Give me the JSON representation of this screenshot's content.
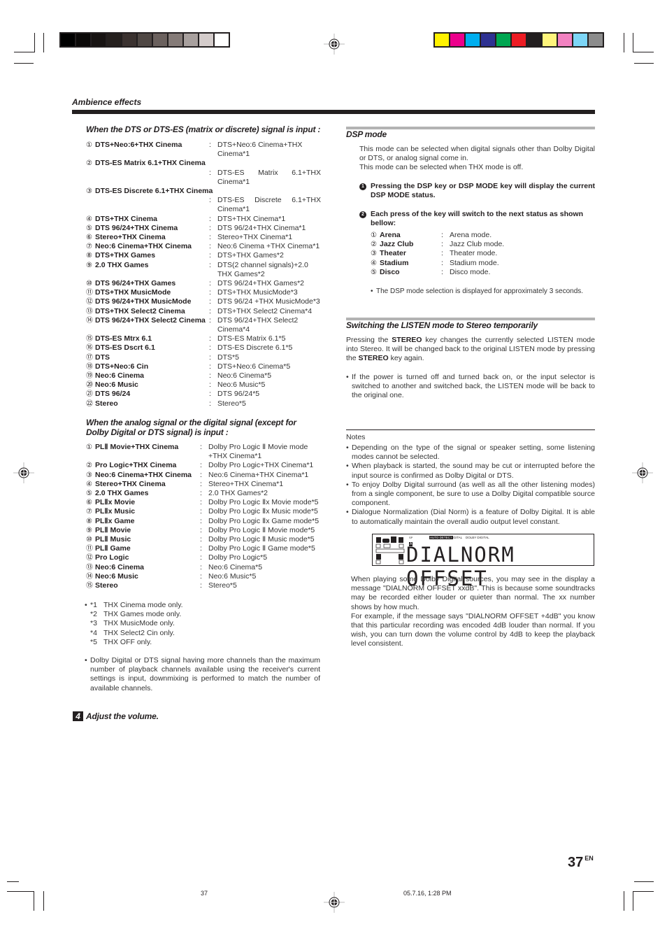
{
  "printer_marks": {
    "grayscale_colors": [
      "#000000",
      "#0b0908",
      "#181413",
      "#25201e",
      "#3b3230",
      "#4f4744",
      "#6b615e",
      "#857b78",
      "#a8a09e",
      "#d4cccb",
      "#ffffff"
    ],
    "process_colors": [
      "#fff200",
      "#ec008c",
      "#00aeef",
      "#2e3192",
      "#00a651",
      "#ed1c24",
      "#231f20",
      "#fff57c",
      "#f282c1",
      "#7dd6f7",
      "#8c8c8c"
    ]
  },
  "header": {
    "section_title": "Ambience effects"
  },
  "left": {
    "dts_heading": "When the DTS or DTS-ES (matrix or discrete) signal is input :",
    "dts_modes": [
      {
        "num": "①",
        "name": "DTS+Neo:6+THX Cinema",
        "desc": "DTS+Neo:6 Cinema+THX Cinema*1",
        "wrap": false
      },
      {
        "num": "②",
        "name": "DTS-ES Matrix 6.1+THX Cinema",
        "desc": "DTS-ES Matrix 6.1+THX Cinema*1",
        "wrap": true
      },
      {
        "num": "③",
        "name": "DTS-ES Discrete 6.1+THX Cinema",
        "desc": "DTS-ES Discrete 6.1+THX Cinema*1",
        "wrap": true
      },
      {
        "num": "④",
        "name": "DTS+THX Cinema",
        "desc": "DTS+THX Cinema*1",
        "wrap": false
      },
      {
        "num": "⑤",
        "name": "DTS 96/24+THX Cinema",
        "desc": "DTS 96/24+THX Cinema*1",
        "wrap": false
      },
      {
        "num": "⑥",
        "name": "Stereo+THX Cinema",
        "desc": "Stereo+THX Cinema*1",
        "wrap": false
      },
      {
        "num": "⑦",
        "name": "Neo:6 Cinema+THX Cinema",
        "desc": "Neo:6 Cinema +THX Cinema*1",
        "wrap": false
      },
      {
        "num": "⑧",
        "name": "DTS+THX Games",
        "desc": "DTS+THX Games*2",
        "wrap": false
      },
      {
        "num": "⑨",
        "name": "2.0 THX Games",
        "desc": "DTS(2 channel signals)+2.0 THX Games*2",
        "wrap": false
      },
      {
        "num": "⑩",
        "name": "DTS 96/24+THX Games",
        "desc": "DTS 96/24+THX Games*2",
        "wrap": false
      },
      {
        "num": "⑪",
        "name": "DTS+THX MusicMode",
        "desc": "DTS+THX MusicMode*3",
        "wrap": false
      },
      {
        "num": "⑫",
        "name": "DTS 96/24+THX MusicMode",
        "desc": "DTS 96/24 +THX MusicMode*3",
        "wrap": false
      },
      {
        "num": "⑬",
        "name": "DTS+THX Select2 Cinema",
        "desc": "DTS+THX Select2 Cinema*4",
        "wrap": false
      },
      {
        "num": "⑭",
        "name": "DTS 96/24+THX Select2 Cinema",
        "desc": "DTS 96/24+THX Select2 Cinema*4",
        "wrap": false
      },
      {
        "num": "⑮",
        "name": "DTS-ES Mtrx 6.1",
        "desc": "DTS-ES Matrix 6.1*5",
        "wrap": false
      },
      {
        "num": "⑯",
        "name": "DTS-ES Dscrt 6.1",
        "desc": "DTS-ES Discrete 6.1*5",
        "wrap": false
      },
      {
        "num": "⑰",
        "name": "DTS",
        "desc": "DTS*5",
        "wrap": false
      },
      {
        "num": "⑱",
        "name": "DTS+Neo:6 Cin",
        "desc": "DTS+Neo:6 Cinema*5",
        "wrap": false
      },
      {
        "num": "⑲",
        "name": "Neo:6 Cinema",
        "desc": "Neo:6 Cinema*5",
        "wrap": false
      },
      {
        "num": "⑳",
        "name": "Neo:6 Music",
        "desc": "Neo:6 Music*5",
        "wrap": false
      },
      {
        "num": "㉑",
        "name": "DTS 96/24",
        "desc": "DTS 96/24*5",
        "wrap": false
      },
      {
        "num": "㉒",
        "name": "Stereo",
        "desc": "Stereo*5",
        "wrap": false
      }
    ],
    "analog_heading": "When the analog signal or the digital signal (except for Dolby Digital or DTS signal) is input :",
    "analog_modes": [
      {
        "num": "①",
        "name": "PLⅡ Movie+THX Cinema",
        "desc": "Dolby Pro Logic Ⅱ Movie mode +THX Cinema*1"
      },
      {
        "num": "②",
        "name": "Pro Logic+THX Cinema",
        "desc": "Dolby Pro Logic+THX Cinema*1"
      },
      {
        "num": "③",
        "name": "Neo:6 Cinema+THX Cinema",
        "desc": "Neo:6 Cinema+THX Cinema*1"
      },
      {
        "num": "④",
        "name": "Stereo+THX Cinema",
        "desc": "Stereo+THX Cinema*1"
      },
      {
        "num": "⑤",
        "name": "2.0 THX Games",
        "desc": "2.0 THX Games*2"
      },
      {
        "num": "⑥",
        "name": "PLⅡx Movie",
        "desc": "Dolby Pro Logic Ⅱx Movie mode*5"
      },
      {
        "num": "⑦",
        "name": "PLⅡx Music",
        "desc": "Dolby Pro Logic Ⅱx Music mode*5"
      },
      {
        "num": "⑧",
        "name": "PLⅡx Game",
        "desc": "Dolby Pro Logic Ⅱx Game mode*5"
      },
      {
        "num": "⑨",
        "name": "PLⅡ Movie",
        "desc": "Dolby Pro Logic Ⅱ Movie mode*5"
      },
      {
        "num": "⑩",
        "name": "PLⅡ Music",
        "desc": "Dolby Pro Logic Ⅱ Music mode*5"
      },
      {
        "num": "⑪",
        "name": "PLⅡ Game",
        "desc": "Dolby Pro Logic Ⅱ Game mode*5"
      },
      {
        "num": "⑫",
        "name": "Pro Logic",
        "desc": "Dolby Pro Logic*5"
      },
      {
        "num": "⑬",
        "name": "Neo:6 Cinema",
        "desc": "Neo:6 Cinema*5"
      },
      {
        "num": "⑭",
        "name": "Neo:6 Music",
        "desc": "Neo:6 Music*5"
      },
      {
        "num": "⑮",
        "name": "Stereo",
        "desc": "Stereo*5"
      }
    ],
    "footnotes": [
      {
        "mark": "*1",
        "text": "THX Cinema mode only."
      },
      {
        "mark": "*2",
        "text": "THX Games mode only."
      },
      {
        "mark": "*3",
        "text": "THX MusicMode only."
      },
      {
        "mark": "*4",
        "text": "THX Select2 Cin only."
      },
      {
        "mark": "*5",
        "text": "THX OFF only."
      }
    ],
    "downmix_note": "Dolby Digital or DTS signal having more channels than the maximum number of playback channels available using the receiver's current settings is input, downmixing is performed to match the number of available channels.",
    "step4": {
      "number": "4",
      "label": "Adjust the volume."
    }
  },
  "right": {
    "dsp": {
      "title": "DSP mode",
      "intro_1": "This mode can be selected when digital signals other than Dolby Digital or DTS, or analog signal come in.",
      "intro_2": "This mode can be selected when THX mode is off.",
      "step1_icon": "1",
      "step1": "Pressing the DSP key or DSP MODE key will display the current DSP MODE status.",
      "step2_icon": "2",
      "step2": "Each press of the key will switch to the next status as shown bellow:",
      "modes": [
        {
          "num": "①",
          "name": "Arena",
          "desc": "Arena mode."
        },
        {
          "num": "②",
          "name": "Jazz Club",
          "desc": "Jazz Club mode."
        },
        {
          "num": "③",
          "name": "Theater",
          "desc": "Theater mode."
        },
        {
          "num": "④",
          "name": "Stadium",
          "desc": "Stadium mode."
        },
        {
          "num": "⑤",
          "name": "Disco",
          "desc": "Disco mode."
        }
      ],
      "note": "The DSP mode selection is displayed for approximately 3 seconds."
    },
    "listen": {
      "title": "Switching the LISTEN mode to Stereo temporarily",
      "p1_a": "Pressing the ",
      "p1_key1": "STEREO",
      "p1_b": " key changes the currently selected LISTEN mode into Stereo. It will be changed back to the original LISTEN mode by pressing the ",
      "p1_key2": "STEREO",
      "p1_c": " key again.",
      "note": "If the power is turned off and turned back on, or the input selector is switched to another and switched back, the LISTEN mode will be back to the original one."
    },
    "notes": {
      "title": "Notes",
      "items": [
        "Depending on the type of the signal or speaker setting, some listening modes cannot be selected.",
        "When playback is started, the sound may be cut or interrupted before the input source is confirmed as Dolby Digital or DTS.",
        "To enjoy Dolby Digital surround (as well as all the other listening modes) from a single component, be sure to use a Dolby Digital compatible source component.",
        "Dialogue Normalization (Dial Norm) is a feature of Dolby Digital. It is able to automatically maintain the overall audio output level constant."
      ]
    },
    "display": {
      "text": "DIALNORM OFFSET",
      "indicator_sp": "SP",
      "indicator_auto": "AUTO DETECT",
      "indicator_digital": "DIGITAL",
      "indicator_dolby": "DOLBY DIGITAL",
      "ch_l": "L",
      "ch_c": "C",
      "ch_r": "R",
      "ch_lfe": "LFE",
      "ch_sl": "SL",
      "ch_sr": "SR",
      "ch_a": "A"
    },
    "dialnorm_p1": "When playing some Dolby Digital sources, you may see in the display a message \"DIALNORM OFFSET xxdB\". This is because some soundtracks may be recorded either louder or quieter than normal. The xx number shows by how much.",
    "dialnorm_p2": "For example, if the message says \"DIALNORM OFFSET +4dB\" you know that this particular recording was encoded 4dB louder than normal. If you wish, you can turn down the volume control by 4dB to keep the playback level consistent."
  },
  "footer": {
    "page_number": "37",
    "page_lang": "EN",
    "slug_page": "37",
    "slug_timestamp": "05.7.16, 1:28 PM"
  }
}
